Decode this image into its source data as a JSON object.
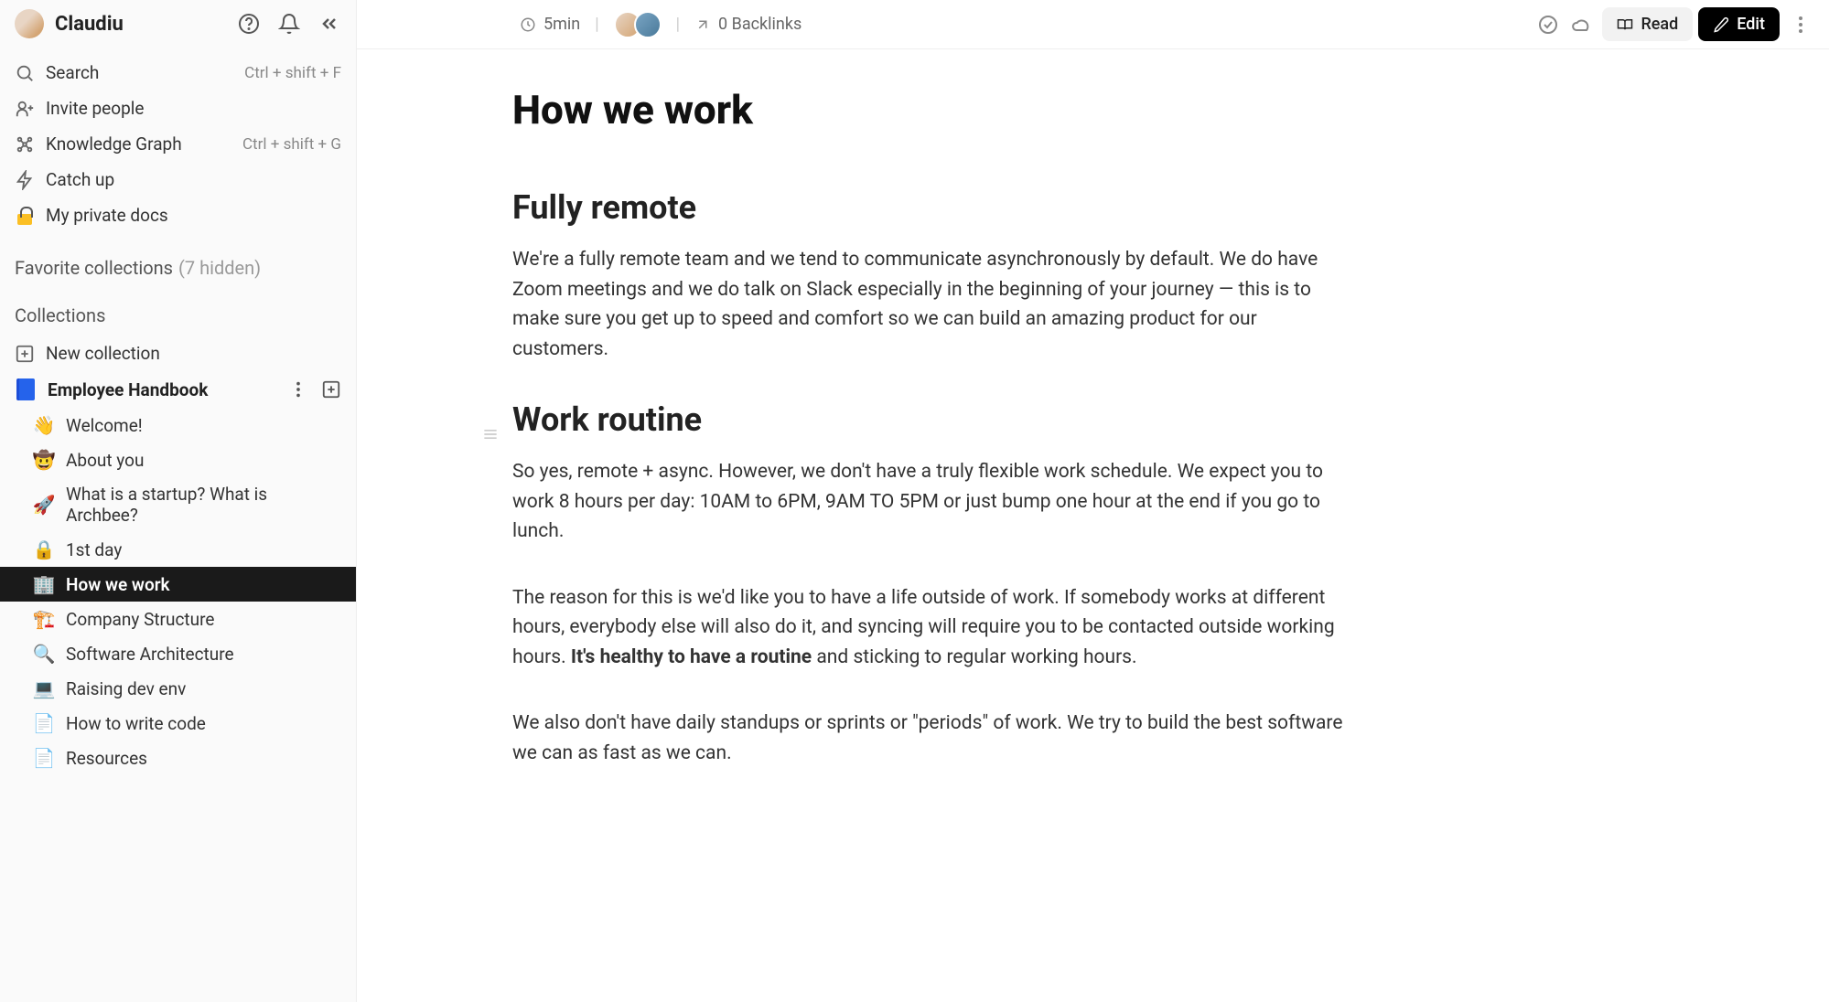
{
  "user": {
    "name": "Claudiu"
  },
  "sidebarNav": {
    "search": {
      "label": "Search",
      "shortcut": "Ctrl + shift + F"
    },
    "invite": {
      "label": "Invite people"
    },
    "graph": {
      "label": "Knowledge Graph",
      "shortcut": "Ctrl + shift + G"
    },
    "catchup": {
      "label": "Catch up"
    },
    "private": {
      "label": "My private docs"
    }
  },
  "favorites": {
    "label": "Favorite collections",
    "hidden": "(7 hidden)"
  },
  "collectionsHeading": "Collections",
  "newCollection": "New collection",
  "collection": {
    "name": "Employee Handbook"
  },
  "docs": [
    {
      "emoji": "👋",
      "label": "Welcome!"
    },
    {
      "emoji": "🤠",
      "label": "About you"
    },
    {
      "emoji": "🚀",
      "label": "What is a startup? What is Archbee?"
    },
    {
      "emoji": "🔒",
      "label": "1st day"
    },
    {
      "emoji": "🏢",
      "label": "How we work"
    },
    {
      "emoji": "🏗️",
      "label": "Company Structure"
    },
    {
      "emoji": "🔍",
      "label": "Software Architecture"
    },
    {
      "emoji": "💻",
      "label": "Raising dev env"
    },
    {
      "emoji": "📄",
      "label": "How to write code"
    },
    {
      "emoji": "📄",
      "label": "Resources"
    }
  ],
  "topbar": {
    "readTime": "5min",
    "backlinks": "0 Backlinks",
    "read": "Read",
    "edit": "Edit"
  },
  "doc": {
    "title": "How we work",
    "section1": {
      "heading": "Fully remote",
      "body": "We're a fully remote team and we tend to communicate asynchronously by default. We do have Zoom meetings and we do talk on Slack especially in the beginning of your journey — this is to make sure you get up to speed and comfort so we can build an amazing product for our customers."
    },
    "section2": {
      "heading": "Work routine",
      "p1": "So yes, remote + async. However, we don't have a truly flexible work schedule. We expect you to work 8 hours per day: 10AM to 6PM, 9AM TO 5PM or just bump one hour at the end if you go to lunch.",
      "p2_a": "The reason for this is we'd like you to have a life outside of work. If somebody works at different hours, everybody else will also do it, and syncing will require you to be contacted outside working hours. ",
      "p2_b": "It's healthy to have a routine",
      "p2_c": " and sticking to regular working hours.",
      "p3": "We also don't have daily standups or sprints or \"periods\" of work. We try to build the best software we can as fast as we can."
    }
  }
}
